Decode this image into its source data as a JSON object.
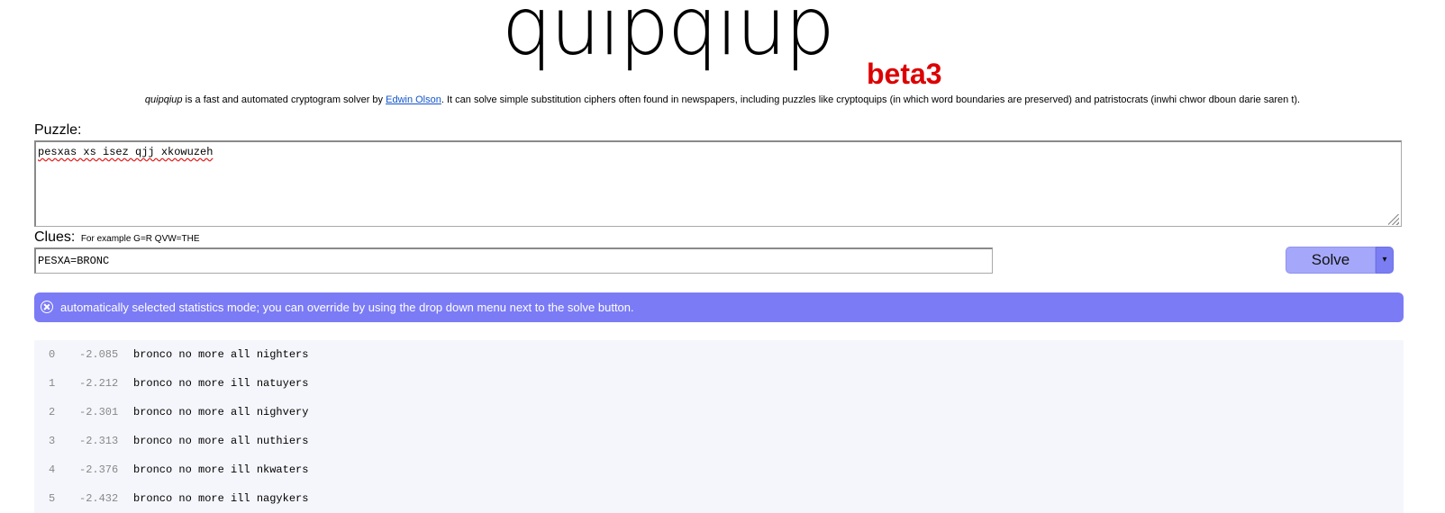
{
  "header": {
    "logo": "quipqiup",
    "version": "beta3"
  },
  "tagline": {
    "app_name": "quipqiup",
    "text_before_link": " is a fast and automated cryptogram solver by ",
    "author_link": "Edwin Olson",
    "text_after_link": ". It can solve simple substitution ciphers often found in newspapers, including puzzles like cryptoquips (in which word boundaries are preserved) and patristocrats (inwhi chwor dboun darie saren t)."
  },
  "puzzle": {
    "label": "Puzzle:",
    "value": "pesxas xs isez qjj xkowuzeh"
  },
  "clues": {
    "label": "Clues:",
    "hint": "For example G=R QVW=THE",
    "value": "PESXA=BRONC"
  },
  "solve": {
    "label": "Solve",
    "dropdown_glyph": "▾"
  },
  "alert": {
    "message": "automatically selected statistics mode; you can override by using the drop down menu next to the solve button.",
    "color": "#7b7bf6"
  },
  "results": [
    {
      "index": "0",
      "score": "-2.085",
      "text": "bronco no more all nighters"
    },
    {
      "index": "1",
      "score": "-2.212",
      "text": "bronco no more ill natuyers"
    },
    {
      "index": "2",
      "score": "-2.301",
      "text": "bronco no more all nighvery"
    },
    {
      "index": "3",
      "score": "-2.313",
      "text": "bronco no more all nuthiers"
    },
    {
      "index": "4",
      "score": "-2.376",
      "text": "bronco no more ill nkwaters"
    },
    {
      "index": "5",
      "score": "-2.432",
      "text": "bronco no more ill nagykers"
    }
  ]
}
